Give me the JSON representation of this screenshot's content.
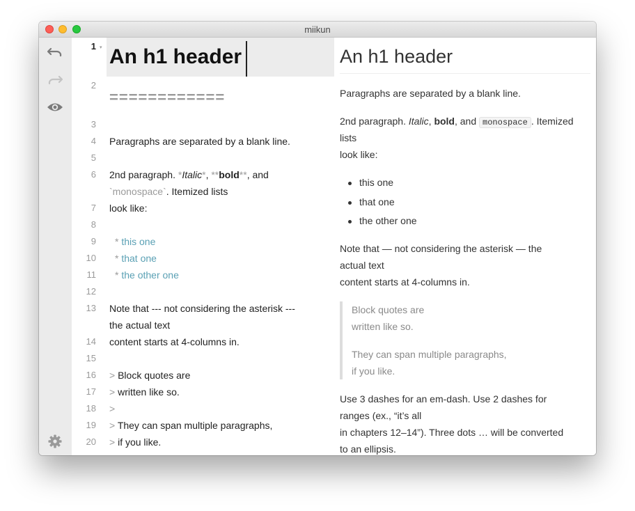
{
  "window": {
    "title": "miikun"
  },
  "sidebar": {
    "undo_icon": "undo-icon",
    "redo_icon": "redo-icon",
    "preview_icon": "eye-icon",
    "settings_icon": "gear-icon"
  },
  "gutter": {
    "line_numbers": [
      "1",
      "2",
      "3",
      "4",
      "5",
      "6",
      "7",
      "8",
      "9",
      "10",
      "11",
      "12",
      "13",
      "14",
      "15",
      "16",
      "17",
      "18",
      "19",
      "20"
    ]
  },
  "editor": {
    "l1": "An h1 header",
    "l2": "============",
    "l4": "Paragraphs are separated by a blank line.",
    "l6a": {
      "pre": "2nd paragraph. ",
      "m1": "*",
      "italic": "Italic",
      "m2": "*",
      "comma": ", ",
      "m3": "**",
      "bold": "bold",
      "m4": "**",
      "and": ", and"
    },
    "l6b": {
      "m1": "`",
      "mono": "monospace",
      "m2": "`",
      "rest": ". Itemized lists"
    },
    "l7": "look like:",
    "l9": {
      "marker": "* ",
      "text": "this one"
    },
    "l10": {
      "marker": "* ",
      "text": "that one"
    },
    "l11": {
      "marker": "* ",
      "text": "the other one"
    },
    "l13a": "Note that --- not considering the asterisk ---",
    "l13b": "the actual text",
    "l14": "content starts at 4-columns in.",
    "l16": {
      "marker": "> ",
      "text": "Block quotes are"
    },
    "l17": {
      "marker": "> ",
      "text": "written like so."
    },
    "l18": {
      "marker": ">"
    },
    "l19": {
      "marker": "> ",
      "text": "They can span multiple paragraphs,"
    },
    "l20": {
      "marker": "> ",
      "text": "if you like."
    }
  },
  "preview": {
    "h1": "An h1 header",
    "p1": "Paragraphs are separated by a blank line.",
    "p2a": {
      "pre": "2nd paragraph. ",
      "italic": "Italic",
      "comma": ", ",
      "bold": "bold",
      "and": ", and ",
      "mono": "monospace",
      "rest": ". Itemized"
    },
    "p2b": "lists",
    "p2c": "look like:",
    "list": [
      "this one",
      "that one",
      "the other one"
    ],
    "p3a": "Note that — not considering the asterisk — the",
    "p3b": "actual text",
    "p3c": "content starts at 4-columns in.",
    "bq1a": "Block quotes are",
    "bq1b": "written like so.",
    "bq2a": "They can span multiple paragraphs,",
    "bq2b": "if you like.",
    "p4a": "Use 3 dashes for an em-dash. Use 2 dashes for",
    "p4b": "ranges (ex., “it’s all",
    "p4c": "in chapters 12–14”). Three dots … will be converted",
    "p4d": "to an ellipsis."
  },
  "colors": {
    "list_marker_text": "#5aa0b4",
    "markup": "#9a9a9a",
    "sidebar_bg": "#ebebeb",
    "active_line_bg": "#ececec"
  }
}
